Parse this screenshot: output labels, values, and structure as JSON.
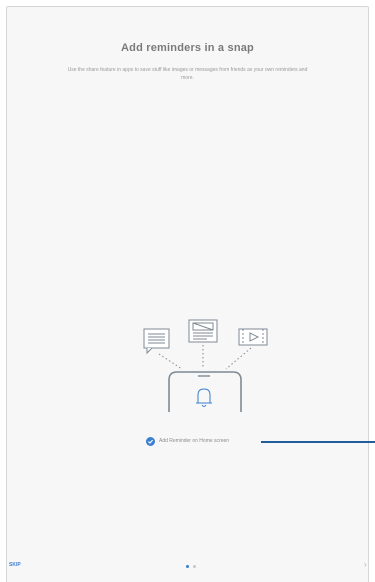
{
  "onboarding": {
    "title": "Add reminders in a snap",
    "description": "Use the share feature in apps to save stuff like images or messages from friends as your own reminders and more.",
    "checkbox_label": "Add Reminder on Home screen",
    "checkbox_checked": true,
    "skip_label": "SKIP",
    "next_icon": "chevron-right-icon",
    "page_indicator": {
      "total": 2,
      "current": 1
    }
  },
  "colors": {
    "accent": "#3a7fd0",
    "callout_line": "#1f5d9c",
    "illustration_stroke": "#7d8a95"
  }
}
